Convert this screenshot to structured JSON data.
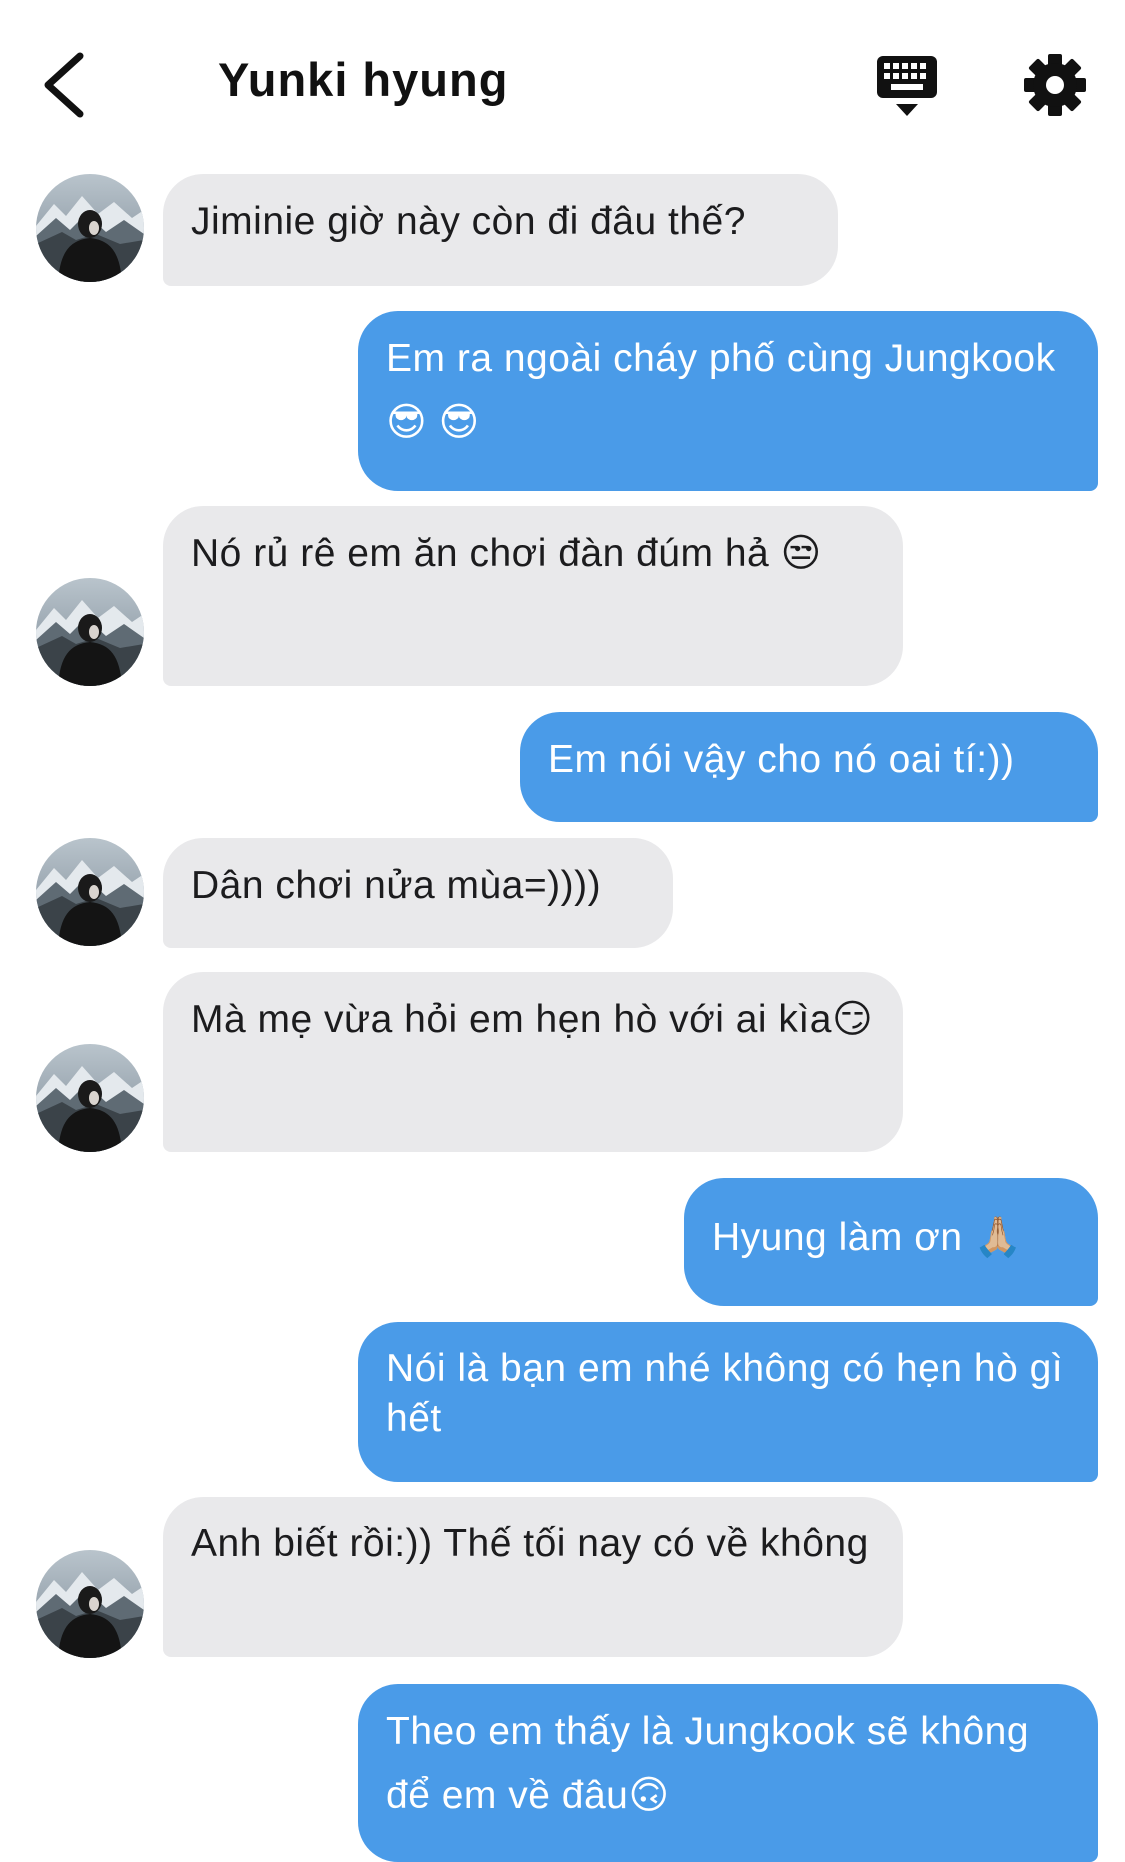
{
  "header": {
    "title": "Yunki hyung",
    "back_icon": "chevron-left-icon",
    "keyboard_icon": "keyboard-icon",
    "settings_icon": "gear-icon"
  },
  "colors": {
    "outgoing_bubble": "#4a9be8",
    "incoming_bubble": "#e9e9eb",
    "outgoing_text": "#ffffff",
    "incoming_text": "#1c1c1e"
  },
  "messages": [
    {
      "direction": "in",
      "text": "Jiminie giờ này còn đi đâu thế?"
    },
    {
      "direction": "out",
      "text": "Em ra ngoài cháy phố cùng Jungkook😎 😎"
    },
    {
      "direction": "in",
      "text": "Nó rủ rê em ăn chơi đàn đúm hả 😒"
    },
    {
      "direction": "out",
      "text": "Em nói vậy cho nó oai tí:))"
    },
    {
      "direction": "in",
      "text": "Dân chơi nửa mùa=))))"
    },
    {
      "direction": "in",
      "text": "Mà mẹ vừa hỏi em hẹn hò với ai kìa😏"
    },
    {
      "direction": "out",
      "text": "Hyung làm ơn 🙏🏼"
    },
    {
      "direction": "out",
      "text": "Nói là bạn em nhé không có hẹn hò gì hết"
    },
    {
      "direction": "in",
      "text": "Anh biết rồi:)) Thế tối nay có về không"
    },
    {
      "direction": "out",
      "text": "Theo em thấy là Jungkook sẽ không để em về đâu🙃"
    }
  ]
}
